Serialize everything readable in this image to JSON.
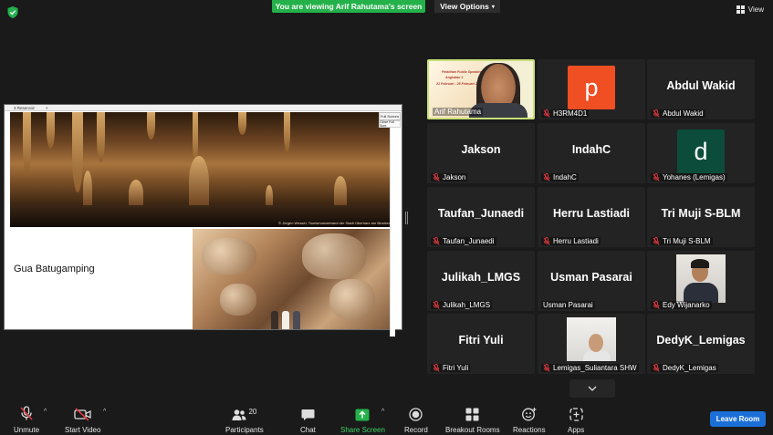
{
  "top_bar": {
    "viewing_banner": "You are viewing Arif Rahutama's screen",
    "view_options": "View Options",
    "view_button": "View"
  },
  "shared_screen": {
    "tab_title": "3 Reservoir",
    "cave_label": "Gua Batugamping",
    "photo_credit": "© Jürgen Wessel, Tourismusverband der Stadt Oberharz am Brocken",
    "full_screen_button": "Full Screen",
    "close_full_screen_button": "Close Full Scre"
  },
  "participants": [
    {
      "display": "",
      "caption": "Arif Rahutama",
      "type": "video-arif",
      "active": true,
      "muted": false
    },
    {
      "display": "p",
      "caption": "H3RM4D1",
      "type": "avatar",
      "avatar_color": "#f04e23",
      "muted": true
    },
    {
      "display": "Abdul Wakid",
      "caption": "Abdul Wakid",
      "type": "name",
      "muted": true
    },
    {
      "display": "Jakson",
      "caption": "Jakson",
      "type": "name",
      "muted": true
    },
    {
      "display": "IndahC",
      "caption": "IndahC",
      "type": "name",
      "muted": true
    },
    {
      "display": "d",
      "caption": "Yohanes (Lemigas)",
      "type": "avatar",
      "avatar_color": "#0b4d3a",
      "muted": true
    },
    {
      "display": "Taufan_Junaedi",
      "caption": "Taufan_Junaedi",
      "type": "name",
      "muted": true
    },
    {
      "display": "Herru Lastiadi",
      "caption": "Herru Lastiadi",
      "type": "name",
      "muted": true
    },
    {
      "display": "Tri Muji S-BLM",
      "caption": "Tri Muji S-BLM",
      "type": "name",
      "muted": true
    },
    {
      "display": "Julikah_LMGS",
      "caption": "Julikah_LMGS",
      "type": "name",
      "muted": true
    },
    {
      "display": "Usman Pasarai",
      "caption": "Usman Pasarai",
      "type": "name",
      "muted": false
    },
    {
      "display": "",
      "caption": "Edy Wijanarko",
      "type": "video-edy",
      "muted": true
    },
    {
      "display": "Fitri Yuli",
      "caption": "Fitri Yuli",
      "type": "name",
      "muted": true
    },
    {
      "display": "",
      "caption": "Lemigas_Suliantara SHW",
      "type": "video-sul",
      "muted": true
    },
    {
      "display": "DedyK_Lemigas",
      "caption": "DedyK_Lemigas",
      "type": "name",
      "muted": true
    }
  ],
  "toolbar": {
    "unmute": "Unmute",
    "start_video": "Start Video",
    "participants": "Participants",
    "participants_count": "20",
    "chat": "Chat",
    "share_screen": "Share Screen",
    "record": "Record",
    "breakout_rooms": "Breakout Rooms",
    "reactions": "Reactions",
    "apps": "Apps",
    "leave_room": "Leave Room"
  },
  "colors": {
    "banner_green": "#24b14a",
    "share_green": "#3fd265",
    "leave_blue": "#1b6fd8",
    "mute_red": "#e0393e"
  }
}
